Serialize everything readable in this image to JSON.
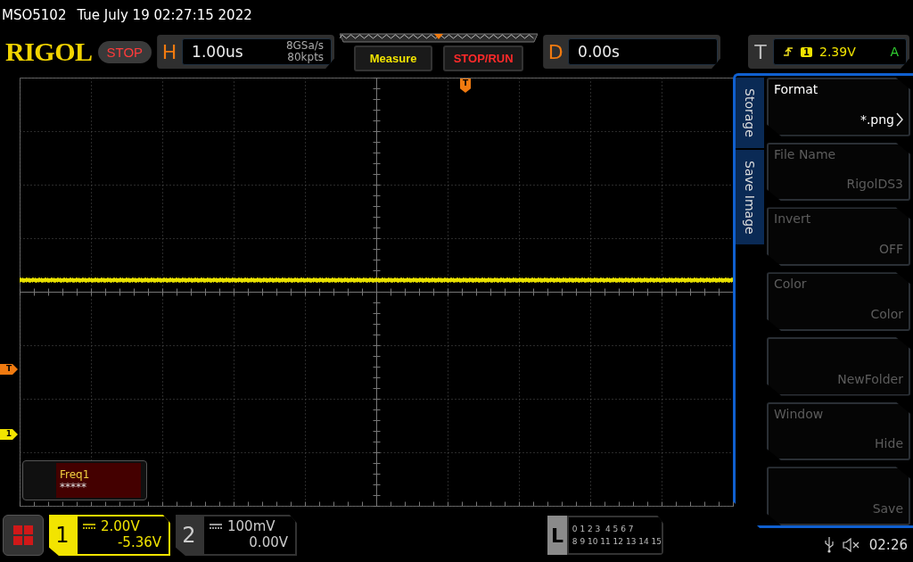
{
  "header": {
    "model": "MSO5102",
    "datetime": "Tue July 19 02:27:15 2022"
  },
  "toolbar": {
    "brand": "RIGOL",
    "run_state": "STOP",
    "horizontal": {
      "key": "H",
      "timebase": "1.00us",
      "sample_rate": "8GSa/s",
      "memory_depth": "80kpts"
    },
    "buttons": [
      {
        "label": "Measure",
        "kind": "measure"
      },
      {
        "label": "STOP/RUN",
        "kind": "stoprun"
      }
    ],
    "delay": {
      "key": "D",
      "value": "0.00s"
    },
    "trigger": {
      "key": "T",
      "source": "1",
      "level": "2.39V",
      "mode": "A"
    }
  },
  "markers": {
    "trigger_position": "T",
    "trigger_level": "T",
    "channel": "1"
  },
  "side_menu": {
    "tabs": [
      {
        "label": "Storage"
      },
      {
        "label": "Save Image"
      }
    ],
    "items": [
      {
        "label": "Format",
        "value": "*.png",
        "disabled": false,
        "submenu": true
      },
      {
        "label": "File Name",
        "value": "RigolDS3",
        "disabled": true,
        "submenu": false
      },
      {
        "label": "Invert",
        "value": "OFF",
        "disabled": true,
        "submenu": false
      },
      {
        "label": "Color",
        "value": "Color",
        "disabled": true,
        "submenu": false
      },
      {
        "value": "NewFolder",
        "disabled": true,
        "submenu": false
      },
      {
        "label": "Window",
        "value": "Hide",
        "disabled": true,
        "submenu": false
      },
      {
        "value": "Save",
        "disabled": true,
        "submenu": false
      }
    ]
  },
  "measurement": {
    "label": "Freq1",
    "value": "*****"
  },
  "channels": [
    {
      "number": "1",
      "scale": "2.00V",
      "offset": "-5.36V",
      "selected": true
    },
    {
      "number": "2",
      "scale": "100mV",
      "offset": "0.00V",
      "selected": false
    }
  ],
  "logic": {
    "key": "L",
    "rows": [
      "0 1 2 3  4 5 6 7",
      "8 9 10 11 12 13 14 15"
    ]
  },
  "status": {
    "time": "02:26"
  }
}
